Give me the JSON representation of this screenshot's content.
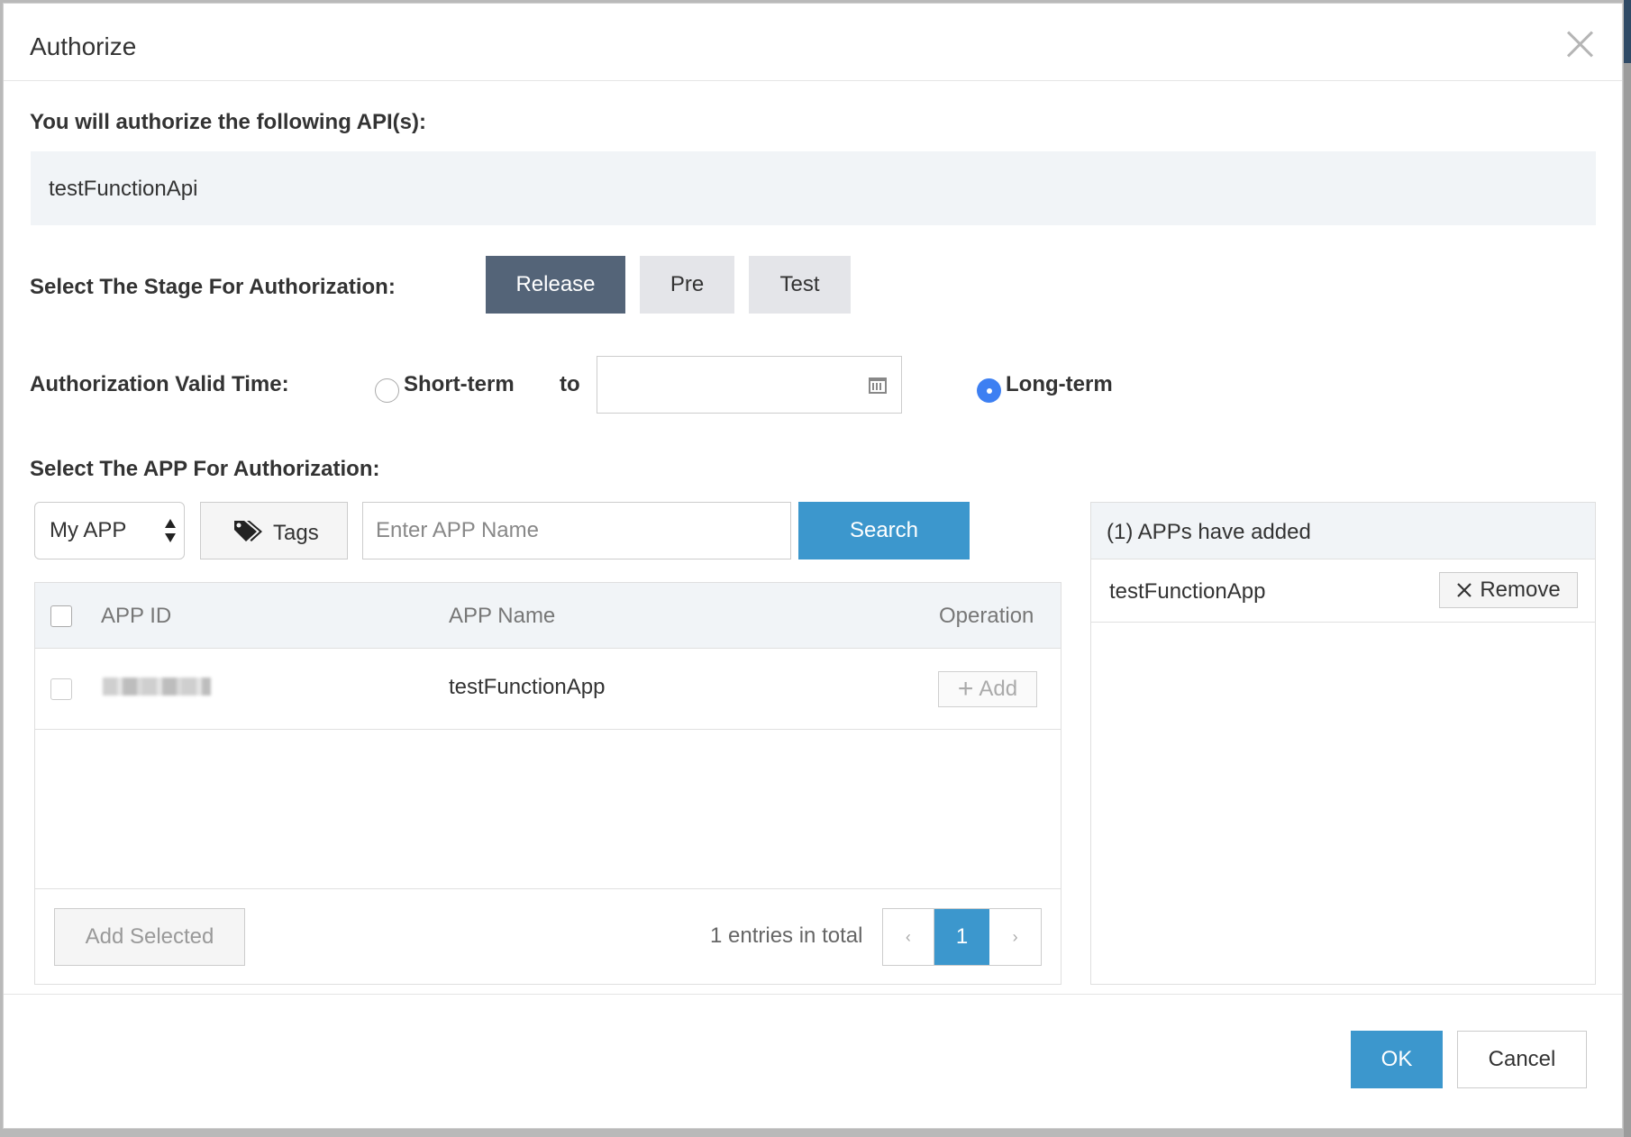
{
  "dialog": {
    "title": "Authorize"
  },
  "api_section": {
    "label": "You will authorize the following API(s):",
    "api_name": "testFunctionApi"
  },
  "stage": {
    "label": "Select The Stage For Authorization:",
    "options": [
      "Release",
      "Pre",
      "Test"
    ],
    "selected": "Release"
  },
  "valid_time": {
    "label": "Authorization Valid Time:",
    "short_term_label": "Short-term",
    "to_label": "to",
    "date_value": "",
    "long_term_label": "Long-term",
    "selected": "Long-term"
  },
  "app_section": {
    "label": "Select The APP For Authorization:",
    "filter_select": "My APP",
    "tags_label": "Tags",
    "search_placeholder": "Enter APP Name",
    "search_button": "Search"
  },
  "table": {
    "columns": [
      "APP ID",
      "APP Name",
      "Operation"
    ],
    "rows": [
      {
        "app_id": "",
        "app_name": "testFunctionApp",
        "operation": "Add"
      }
    ],
    "add_selected": "Add Selected",
    "total_text": "1 entries in total",
    "pager": {
      "prev": "‹",
      "current": "1",
      "next": "›"
    }
  },
  "added_panel": {
    "title": "(1) APPs have added",
    "items": [
      {
        "name": "testFunctionApp",
        "action": "Remove"
      }
    ]
  },
  "footer": {
    "ok": "OK",
    "cancel": "Cancel"
  },
  "colors": {
    "primary": "#3c97cd",
    "stage_active": "#546478",
    "radio_checked": "#3d7ff2"
  }
}
